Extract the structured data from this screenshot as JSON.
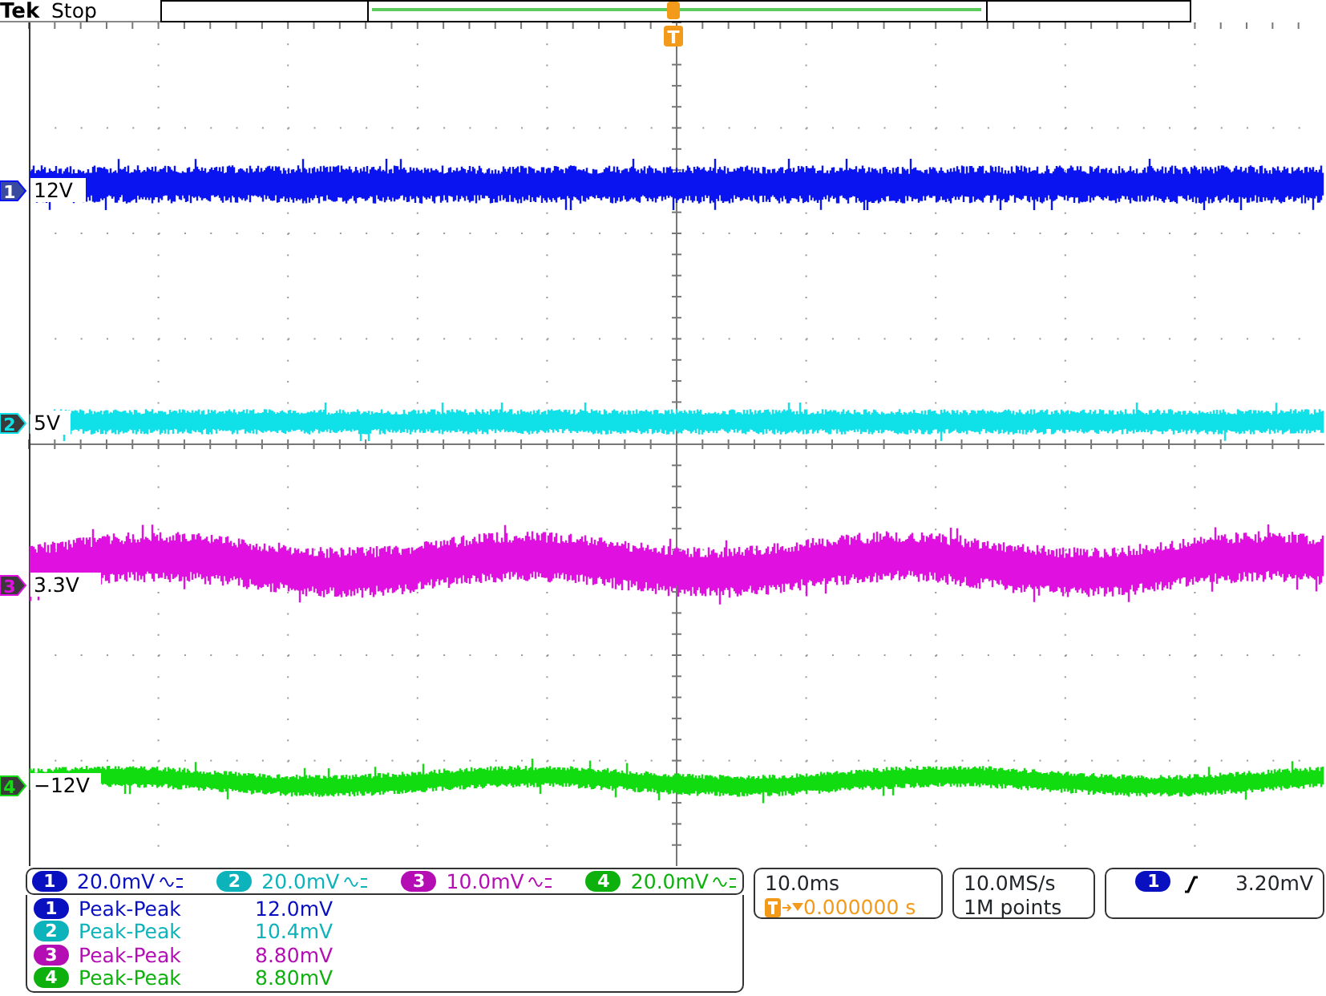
{
  "header": {
    "brand": "Tek",
    "status": "Stop",
    "trigger_marker": "T"
  },
  "channels": [
    {
      "number": "1",
      "marker_number": "1",
      "color": "#0a14f0",
      "label": "12V",
      "scale": "20.0mV"
    },
    {
      "number": "2",
      "marker_number": "2",
      "color": "#10e0e8",
      "label": "5V",
      "scale": "20.0mV"
    },
    {
      "number": "3",
      "marker_number": "3",
      "color": "#e010e0",
      "label": "3.3V",
      "scale": "10.0mV"
    },
    {
      "number": "4",
      "marker_number": "4",
      "color": "#10dc10",
      "label": "−12V",
      "scale": "20.0mV"
    }
  ],
  "measurements": [
    {
      "channel": "1",
      "name": "Peak-Peak",
      "value": "12.0mV"
    },
    {
      "channel": "2",
      "name": "Peak-Peak",
      "value": "10.4mV"
    },
    {
      "channel": "3",
      "name": "Peak-Peak",
      "value": "8.80mV"
    },
    {
      "channel": "4",
      "name": "Peak-Peak",
      "value": "8.80mV"
    }
  ],
  "timebase": {
    "scale": "10.0ms",
    "position": "0.000000 s"
  },
  "acquisition": {
    "rate": "10.0MS/s",
    "length": "1M points"
  },
  "trigger": {
    "source": "1",
    "level": "3.20mV"
  }
}
